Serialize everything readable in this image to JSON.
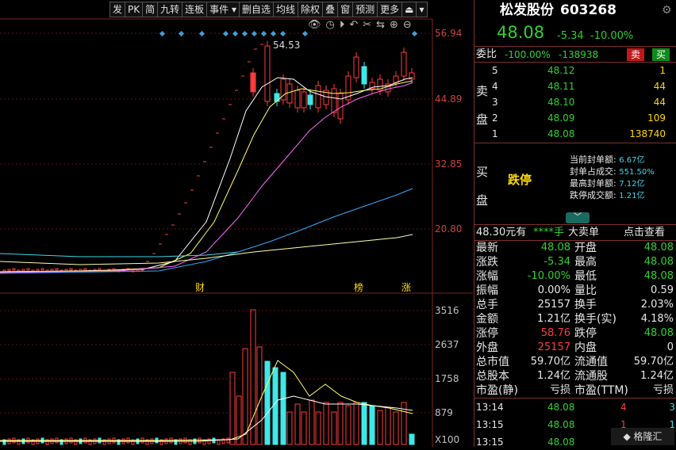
{
  "toolbar": {
    "buttons": [
      "发",
      "PK",
      "简",
      "九转",
      "连板",
      "事件 ▾",
      "删自选",
      "均线",
      "除权",
      "叠",
      "窗",
      "预测",
      "更多",
      "⏏",
      "▾"
    ]
  },
  "chart": {
    "price_ticks": [
      "56.94",
      "44.89",
      "32.85",
      "20.80"
    ],
    "high_label": "54.53",
    "markers": [
      "财",
      "榜",
      "涨"
    ],
    "volume_ticks": [
      "3516",
      "2637",
      "1758",
      "879"
    ],
    "volume_unit": "X100",
    "candle_colors": {
      "up": "#ff3b3b",
      "down": "#3fe8e8",
      "ma5": "#ffffff",
      "ma10": "#ffff66",
      "ma20": "#ff66ff",
      "ma60": "#33aaff",
      "ma120": "#ffffaa"
    }
  },
  "stock": {
    "name": "松发股份",
    "code": "603268",
    "price": "48.08",
    "change": "-5.34",
    "change_pct": "-10.00%"
  },
  "order_ratio": {
    "label": "委比",
    "pct": "-100.00%",
    "diff": "-138938",
    "sell_btn": "卖",
    "buy_btn": "买"
  },
  "sell_side": {
    "label1": "卖",
    "label2": "盘",
    "levels": [
      {
        "n": "5",
        "price": "48.12",
        "vol": "1"
      },
      {
        "n": "4",
        "price": "48.11",
        "vol": "44"
      },
      {
        "n": "3",
        "price": "48.10",
        "vol": "44"
      },
      {
        "n": "2",
        "price": "48.09",
        "vol": "109"
      },
      {
        "n": "1",
        "price": "48.08",
        "vol": "138740"
      }
    ]
  },
  "buy_side": {
    "label1": "买",
    "label2": "盘",
    "status": "跌停",
    "stats": [
      {
        "k": "当前封单额:",
        "v": "6.67亿"
      },
      {
        "k": "封单占成交:",
        "v": "551.50%"
      },
      {
        "k": "最高封单额:",
        "v": "7.12亿"
      },
      {
        "k": "跌停成交额:",
        "v": "1.21亿"
      }
    ]
  },
  "big_order": {
    "price": "48.30元有",
    "stars": "****手",
    "label": "大卖单",
    "link": "点击查看"
  },
  "quote_table": [
    {
      "l1": "最新",
      "v1": "48.08",
      "l2": "开盘",
      "v2": "48.08"
    },
    {
      "l1": "涨跌",
      "v1": "-5.34",
      "l2": "最高",
      "v2": "48.08"
    },
    {
      "l1": "涨幅",
      "v1": "-10.00%",
      "l2": "最低",
      "v2": "48.08"
    },
    {
      "l1": "振幅",
      "v1": "0.00%",
      "l2": "量比",
      "v2": "0.59"
    },
    {
      "l1": "总手",
      "v1": "25157",
      "l2": "换手",
      "v2": "2.03%"
    },
    {
      "l1": "金额",
      "v1": "1.21亿",
      "l2": "换手(实)",
      "v2": "4.18%"
    },
    {
      "l1": "涨停",
      "v1": "58.76",
      "l2": "跌停",
      "v2": "48.08"
    },
    {
      "l1": "外盘",
      "v1": "25157",
      "l2": "内盘",
      "v2": "0"
    },
    {
      "l1": "总市值",
      "v1": "59.70亿",
      "l2": "流通值",
      "v2": "59.70亿"
    },
    {
      "l1": "总股本",
      "v1": "1.24亿",
      "l2": "流通股",
      "v2": "1.24亿"
    },
    {
      "l1": "市盈(静)",
      "v1": "亏损",
      "l2": "市盈(TTM)",
      "v2": "亏损"
    }
  ],
  "ticks": [
    {
      "time": "13:14",
      "price": "48.08",
      "vol": "4",
      "dir": "3"
    },
    {
      "time": "13:15",
      "price": "48.08",
      "vol": "1",
      "dir": "1"
    },
    {
      "time": "13:15",
      "price": "48.08",
      "vol": "",
      "dir": ""
    }
  ],
  "watermark": "格隆汇"
}
